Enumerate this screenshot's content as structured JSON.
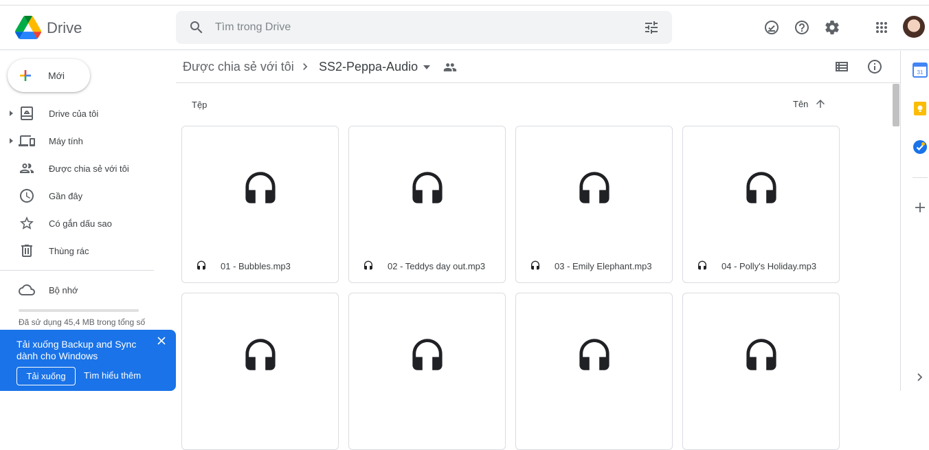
{
  "header": {
    "brand": "Drive",
    "search_placeholder": "Tìm trong Drive",
    "icons": [
      "search-icon",
      "filter-options-icon",
      "offline-status-icon",
      "help-icon",
      "settings-icon",
      "apps-grid-icon",
      "avatar"
    ]
  },
  "sidebar": {
    "new_label": "Mới",
    "items": [
      {
        "label": "Drive của tôi",
        "icon": "my-drive-icon",
        "expandable": true
      },
      {
        "label": "Máy tính",
        "icon": "computers-icon",
        "expandable": true
      },
      {
        "label": "Được chia sẻ với tôi",
        "icon": "shared-people-icon",
        "expandable": false
      },
      {
        "label": "Gần đây",
        "icon": "clock-icon",
        "expandable": false
      },
      {
        "label": "Có gắn dấu sao",
        "icon": "star-icon",
        "expandable": false
      },
      {
        "label": "Thùng rác",
        "icon": "trash-icon",
        "expandable": false
      }
    ],
    "storage_label": "Bộ nhớ",
    "storage_used_text": "Đã sử dụng 45,4 MB trong tổng số"
  },
  "promo": {
    "title": "Tải xuống Backup and Sync dành cho Windows",
    "download_label": "Tải xuống",
    "learn_more_label": "Tìm hiểu thêm"
  },
  "breadcrumb": {
    "parent": "Được chia sẻ với tôi",
    "current": "SS2-Peppa-Audio"
  },
  "files": {
    "section_label": "Tệp",
    "sort_label": "Tên",
    "items": [
      {
        "name": "01 - Bubbles.mp3"
      },
      {
        "name": "02 - Teddys day out.mp3"
      },
      {
        "name": "03 - Emily Elephant.mp3"
      },
      {
        "name": "04 - Polly's Holiday.mp3"
      },
      {
        "name": ""
      },
      {
        "name": ""
      },
      {
        "name": ""
      },
      {
        "name": ""
      }
    ]
  },
  "colors": {
    "accent": "#1a73e8",
    "border": "#dadce0",
    "text": "#3c4043",
    "icon": "#5f6368"
  }
}
